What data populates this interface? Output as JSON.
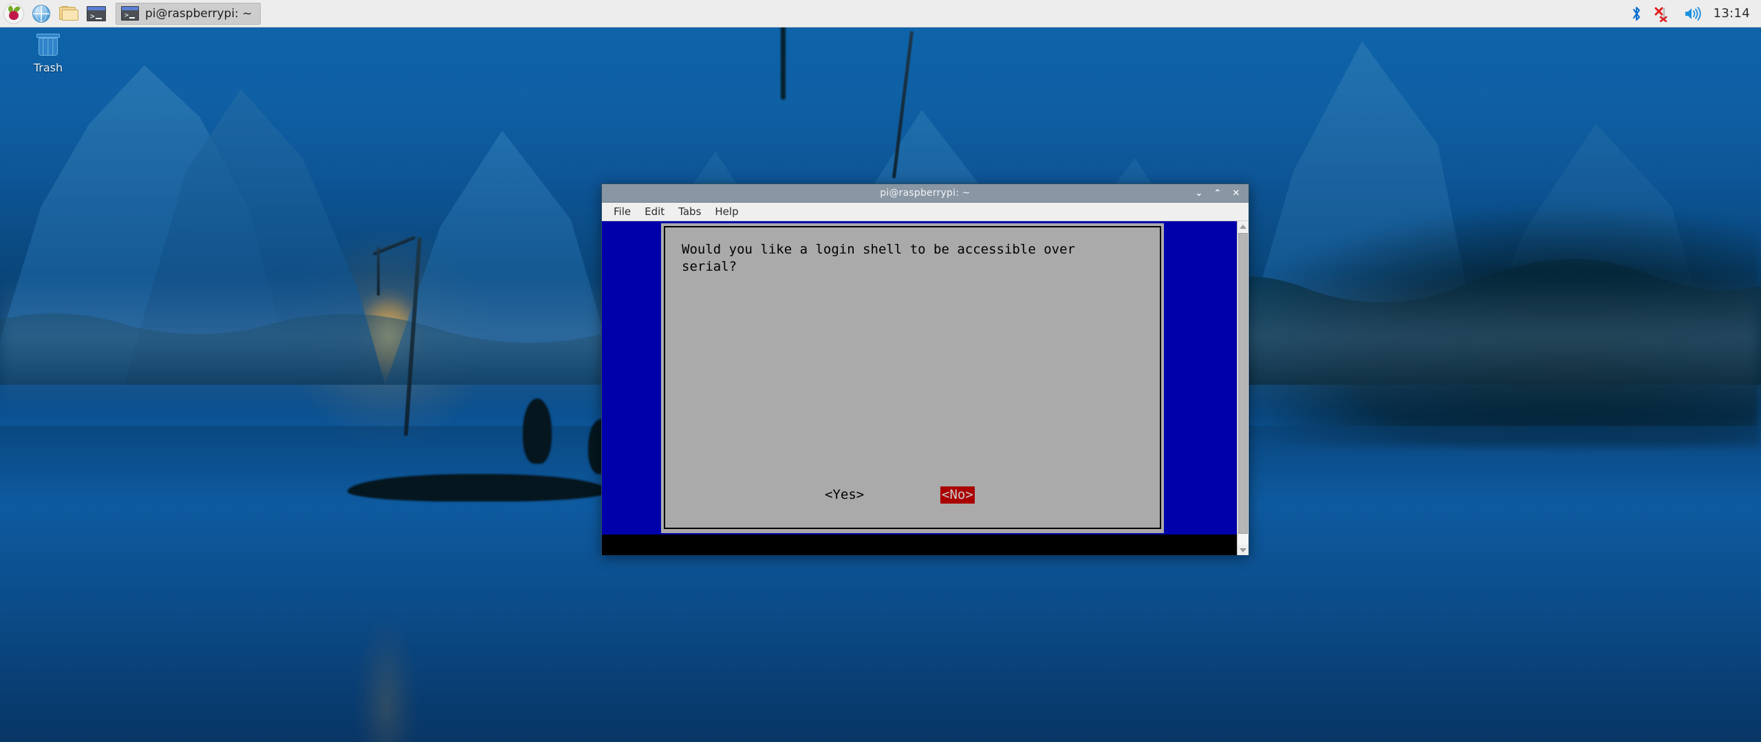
{
  "panel": {
    "launchers": [
      {
        "name": "raspberry-menu",
        "icon": "raspberry-icon",
        "label": "Menu"
      },
      {
        "name": "web-browser",
        "icon": "globe-icon",
        "label": "Web Browser"
      },
      {
        "name": "file-manager",
        "icon": "folder-icon",
        "label": "File Manager"
      },
      {
        "name": "terminal",
        "icon": "terminal-icon",
        "label": "Terminal"
      }
    ],
    "task_button": {
      "icon": "terminal-icon",
      "label": "pi@raspberrypi: ~"
    },
    "tray": {
      "bluetooth_icon": "bluetooth-icon",
      "network_icon": "network-disconnected-icon",
      "volume_icon": "volume-icon",
      "clock": "13:14"
    }
  },
  "desktop": {
    "icons": [
      {
        "name": "trash",
        "label": "Trash",
        "icon": "trash-icon"
      }
    ]
  },
  "window": {
    "title": "pi@raspberrypi: ~",
    "controls": {
      "minimize": "⌄",
      "maximize": "⌃",
      "close": "✕"
    },
    "menu": [
      {
        "label": "File"
      },
      {
        "label": "Edit"
      },
      {
        "label": "Tabs"
      },
      {
        "label": "Help"
      }
    ],
    "terminal": {
      "background_color": "#0000aa",
      "dialog": {
        "background_color": "#aaaaaa",
        "text": "Would you like a login shell to be accessible over\nserial?",
        "buttons": [
          {
            "label": "<Yes>",
            "selected": false
          },
          {
            "label": "<No>",
            "selected": true
          }
        ],
        "selected_color": "#aa0000"
      }
    }
  }
}
